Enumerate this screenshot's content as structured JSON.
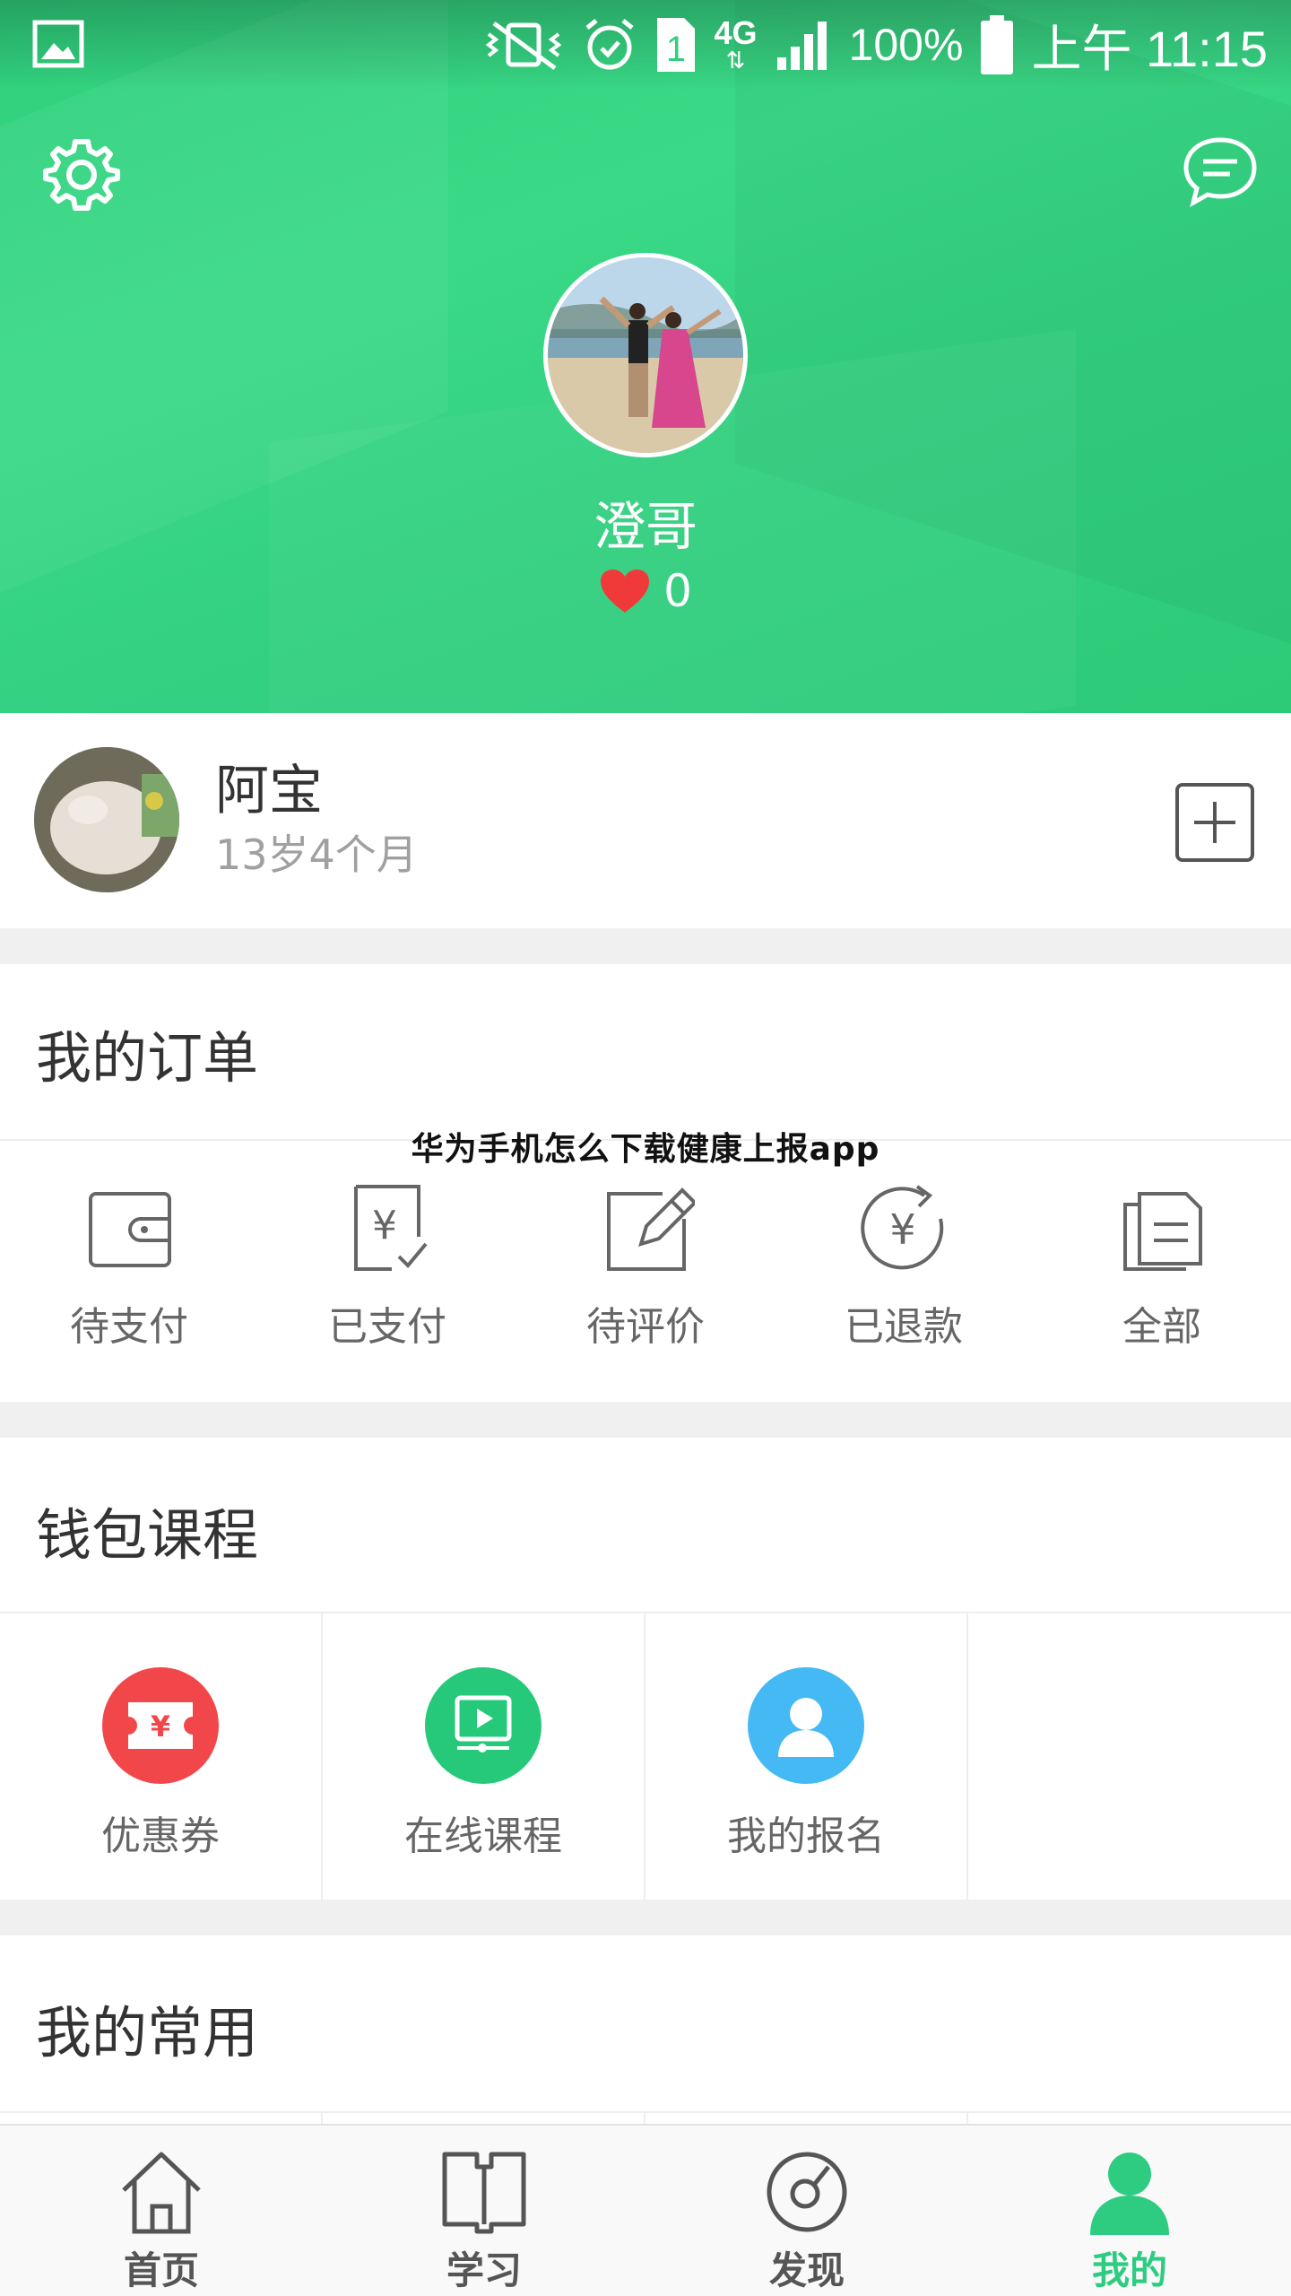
{
  "status_bar": {
    "network": "4G",
    "sim": "1",
    "battery": "100%",
    "time": "上午 11:15"
  },
  "profile": {
    "username": "澄哥",
    "likes": "0"
  },
  "child": {
    "name": "阿宝",
    "age": "13岁4个月"
  },
  "orders": {
    "title": "我的订单",
    "items": [
      {
        "label": "待支付",
        "icon": "wallet-icon"
      },
      {
        "label": "已支付",
        "icon": "paid-receipt-icon"
      },
      {
        "label": "待评价",
        "icon": "edit-review-icon"
      },
      {
        "label": "已退款",
        "icon": "refund-icon"
      },
      {
        "label": "全部",
        "icon": "all-orders-icon"
      }
    ]
  },
  "watermark": "华为手机怎么下载健康上报app",
  "wallet": {
    "title": "钱包课程",
    "items": [
      {
        "label": "优惠券",
        "icon": "coupon-icon",
        "color": "#f2474a"
      },
      {
        "label": "在线课程",
        "icon": "online-course-icon",
        "color": "#26c97a"
      },
      {
        "label": "我的报名",
        "icon": "registration-icon",
        "color": "#44b9f3"
      }
    ]
  },
  "common": {
    "title": "我的常用"
  },
  "bottom_nav": {
    "items": [
      {
        "label": "首页",
        "icon": "home-icon"
      },
      {
        "label": "学习",
        "icon": "book-icon"
      },
      {
        "label": "发现",
        "icon": "discover-icon"
      },
      {
        "label": "我的",
        "icon": "profile-icon",
        "active": true
      }
    ]
  },
  "colors": {
    "header_green": "#33d181",
    "accent_green": "#2ecc80",
    "like_red": "#f03a3a"
  }
}
